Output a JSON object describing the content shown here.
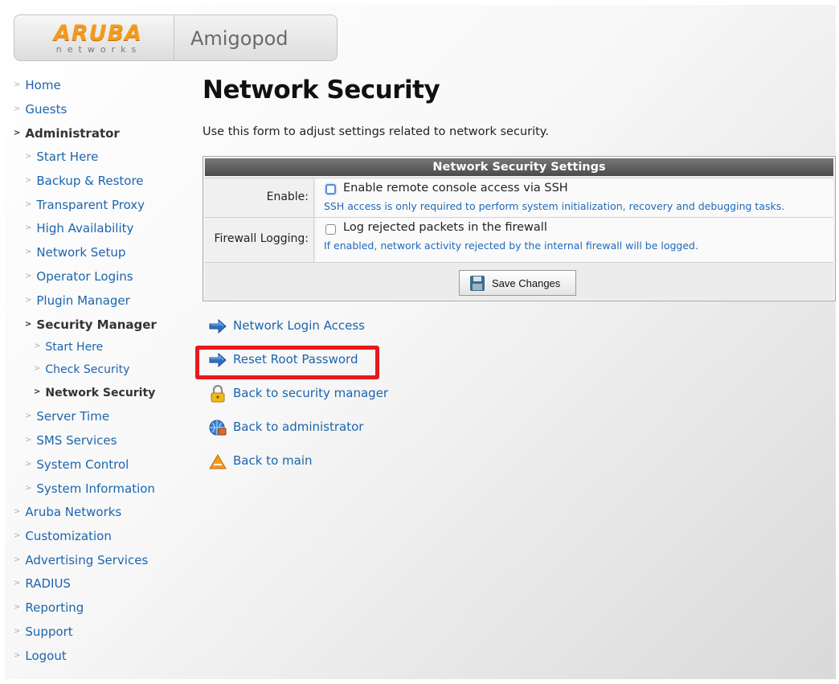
{
  "header": {
    "logo_word": "ARUBA",
    "logo_sub": "networks",
    "brand": "Amigopod"
  },
  "sidebar": {
    "items": [
      {
        "label": "Home",
        "level": 0,
        "active": false
      },
      {
        "label": "Guests",
        "level": 0,
        "active": false
      },
      {
        "label": "Administrator",
        "level": 0,
        "active": true
      },
      {
        "label": "Start Here",
        "level": 1,
        "active": false
      },
      {
        "label": "Backup & Restore",
        "level": 1,
        "active": false
      },
      {
        "label": "Transparent Proxy",
        "level": 1,
        "active": false
      },
      {
        "label": "High Availability",
        "level": 1,
        "active": false
      },
      {
        "label": "Network Setup",
        "level": 1,
        "active": false
      },
      {
        "label": "Operator Logins",
        "level": 1,
        "active": false
      },
      {
        "label": "Plugin Manager",
        "level": 1,
        "active": false
      },
      {
        "label": "Security Manager",
        "level": 1,
        "active": true
      },
      {
        "label": "Start Here",
        "level": 2,
        "active": false
      },
      {
        "label": "Check Security",
        "level": 2,
        "active": false
      },
      {
        "label": "Network Security",
        "level": 2,
        "active": true
      },
      {
        "label": "Server Time",
        "level": 1,
        "active": false
      },
      {
        "label": "SMS Services",
        "level": 1,
        "active": false
      },
      {
        "label": "System Control",
        "level": 1,
        "active": false
      },
      {
        "label": "System Information",
        "level": 1,
        "active": false
      },
      {
        "label": "Aruba Networks",
        "level": 0,
        "active": false
      },
      {
        "label": "Customization",
        "level": 0,
        "active": false
      },
      {
        "label": "Advertising Services",
        "level": 0,
        "active": false
      },
      {
        "label": "RADIUS",
        "level": 0,
        "active": false
      },
      {
        "label": "Reporting",
        "level": 0,
        "active": false
      },
      {
        "label": "Support",
        "level": 0,
        "active": false
      },
      {
        "label": "Logout",
        "level": 0,
        "active": false
      }
    ]
  },
  "main": {
    "title": "Network Security",
    "intro": "Use this form to adjust settings related to network security.",
    "form": {
      "header": "Network Security Settings",
      "enable_label": "Enable:",
      "enable_option": "Enable remote console access via SSH",
      "enable_checked": false,
      "enable_hint": "SSH access is only required to perform system initialization, recovery and debugging tasks.",
      "firewall_label": "Firewall Logging:",
      "firewall_option": "Log rejected packets in the firewall",
      "firewall_checked": false,
      "firewall_hint": "If enabled, network activity rejected by the internal firewall will be logged.",
      "save_label": "Save Changes"
    },
    "links": [
      {
        "label": "Network Login Access",
        "icon": "arrow-right-icon"
      },
      {
        "label": "Reset Root Password",
        "icon": "arrow-right-icon",
        "highlighted": true
      },
      {
        "label": "Back to security manager",
        "icon": "lock-icon"
      },
      {
        "label": "Back to administrator",
        "icon": "admin-globe-icon"
      },
      {
        "label": "Back to main",
        "icon": "aruba-logo-icon"
      }
    ],
    "highlight_color": "#e8191b"
  }
}
